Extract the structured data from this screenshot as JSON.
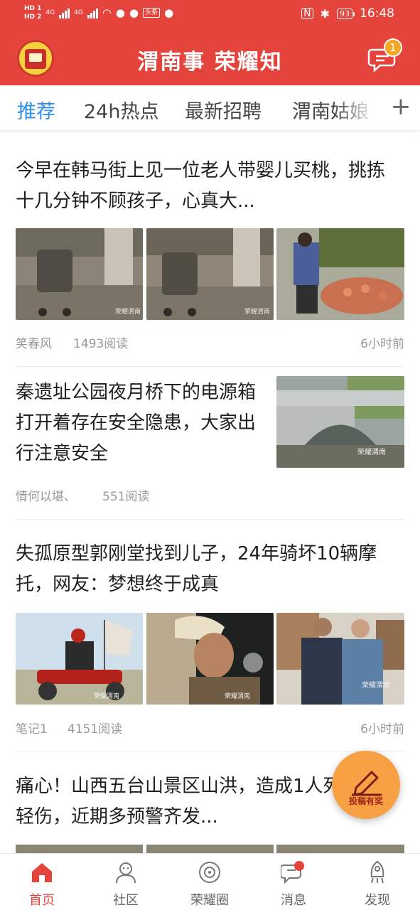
{
  "status_bar": {
    "left_labels": [
      "HD 1",
      "HD 2",
      "4G",
      "4G"
    ],
    "battery": "93",
    "time": "16:48"
  },
  "header": {
    "title": "渭南事 荣耀知",
    "message_badge_count": "1",
    "brand_color": "#e5443c"
  },
  "tabs": {
    "items": [
      {
        "label": "推荐",
        "active": true
      },
      {
        "label": "24h热点",
        "active": false
      },
      {
        "label": "最新招聘",
        "active": false
      },
      {
        "label": "渭南姑娘",
        "active": false
      }
    ],
    "add_label": "+",
    "active_color": "#2b8ee8"
  },
  "feed": [
    {
      "title": "今早在韩马街上见一位老人带婴儿买桃，挑拣十几分钟不顾孩子，心真大...",
      "author": "笑春风",
      "reads": "1493阅读",
      "time": "6小时前",
      "images": [
        "stroller-under-tree",
        "stroller-under-tree",
        "man-buying-peaches"
      ]
    },
    {
      "title": "秦遗址公园夜月桥下的电源箱打开着存在安全隐患，大家出行注意安全",
      "author": "情何以堪、",
      "reads": "551阅读",
      "time": "",
      "images": [
        "arched-bridge"
      ]
    },
    {
      "title": "失孤原型郭刚堂找到儿子，24年骑坏10辆摩托，网友：梦想终于成真",
      "author": "笔记1",
      "reads": "4151阅读",
      "time": "6小时前",
      "images": [
        "motorcycle-rider",
        "actor-in-cap",
        "two-men-portrait"
      ]
    },
    {
      "title": "痛心！山西五台山景区山洪，造成1人死亡3人轻伤，近期多预警齐发...",
      "author": "",
      "reads": "",
      "time": "",
      "images": []
    }
  ],
  "watermark": "荣耀渭南",
  "fab": {
    "label": "投稿有奖",
    "icon": "pen-write-icon"
  },
  "bottom_nav": [
    {
      "label": "首页",
      "icon": "home-icon",
      "active": true
    },
    {
      "label": "社区",
      "icon": "community-icon",
      "active": false
    },
    {
      "label": "荣耀圈",
      "icon": "circle-icon",
      "active": false
    },
    {
      "label": "消息",
      "icon": "message-icon",
      "active": false
    },
    {
      "label": "发现",
      "icon": "rocket-icon",
      "active": false
    }
  ]
}
